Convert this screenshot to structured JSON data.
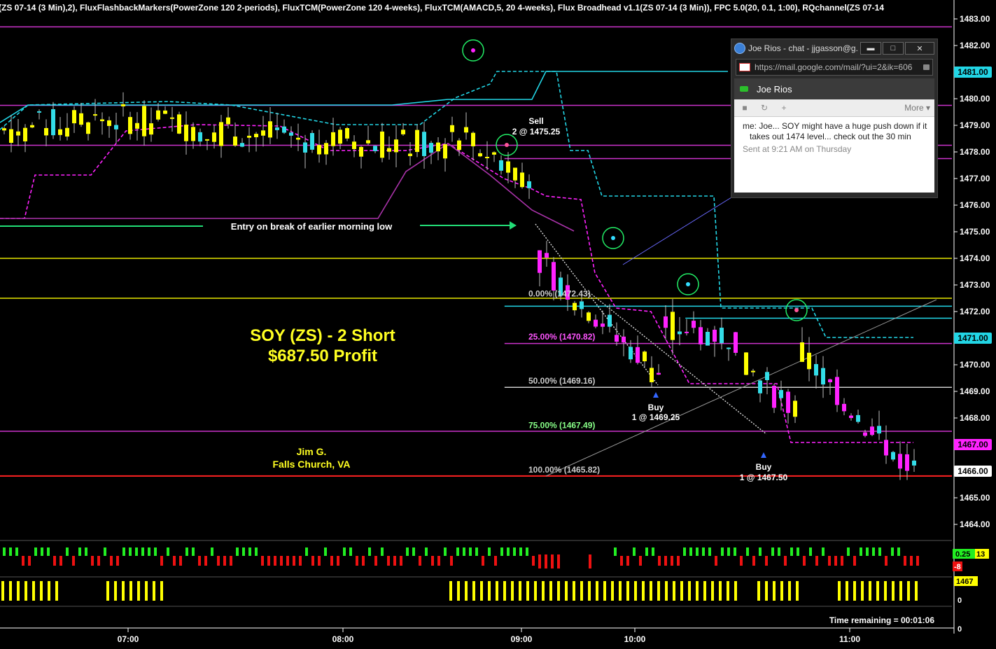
{
  "indicator_header": "(ZS 07-14 (3 Min),2),  FluxFlashbackMarkers(PowerZone 120 2-periods),  FluxTCM(PowerZone 120 4-weeks),  FluxTCM(AMACD,5, 20 4-weeks),  Flux Broadhead v1.1(ZS 07-14 (3 Min)),  FPC 5.0(20, 0.1, 1:00),  RQchannel(ZS 07-14",
  "colors": {
    "bull": "#33dde8",
    "bear": "#ff22ff",
    "neutral": "#ffff00",
    "resistance_cyan": "#22d6e6",
    "magenta_level": "#cc33cc",
    "yellow_level": "#e6e600",
    "red_level": "#ff2222",
    "fib": "#cccccc",
    "chat_video": "#2bbf2b"
  },
  "chart_data": {
    "type": "candlestick",
    "y_axis": {
      "min": 1463.5,
      "max": 1483.3,
      "ticks": [
        "1483.00",
        "1482.00",
        "1481.00",
        "1480.00",
        "1479.00",
        "1478.00",
        "1477.00",
        "1476.00",
        "1475.00",
        "1474.00",
        "1473.00",
        "1472.00",
        "1471.00",
        "1470.00",
        "1469.00",
        "1468.00",
        "1467.00",
        "1466.00",
        "1465.00",
        "1464.00"
      ]
    },
    "x_axis": {
      "ticks": [
        "07:00",
        "08:00",
        "09:00",
        "10:00",
        "11:00"
      ]
    },
    "price_badges": [
      {
        "value": "1481.00",
        "price": 1481.0,
        "color": "#22d6e6"
      },
      {
        "value": "1471.00",
        "price": 1471.0,
        "color": "#22d6e6"
      },
      {
        "value": "1467.00",
        "price": 1467.0,
        "color": "#ff22ff"
      },
      {
        "value": "1466.00",
        "price": 1466.0,
        "color": "#ffffff"
      }
    ],
    "levels": [
      {
        "price": 1482.7,
        "color": "#cc33cc"
      },
      {
        "price": 1479.75,
        "color": "#cc33cc"
      },
      {
        "price": 1478.25,
        "color": "#cc33cc"
      },
      {
        "price": 1477.75,
        "color": "#cc33cc",
        "from": 0.53
      },
      {
        "price": 1474.0,
        "color": "#e6e600"
      },
      {
        "price": 1472.5,
        "color": "#e6e600"
      },
      {
        "price": 1472.2,
        "color": "#22d6e6",
        "from": 0.53
      },
      {
        "price": 1471.75,
        "color": "#22d6e6",
        "from": 0.72
      },
      {
        "price": 1470.8,
        "color": "#cc33cc",
        "from": 0.53
      },
      {
        "price": 1469.15,
        "color": "#cccccc",
        "from": 0.53
      },
      {
        "price": 1467.5,
        "color": "#cc33cc"
      },
      {
        "price": 1465.82,
        "color": "#ff2222"
      }
    ],
    "fib_labels": [
      {
        "text": "0.00% (1472.43)",
        "price": 1472.43
      },
      {
        "text": "25.00% (1470.82)",
        "price": 1470.82
      },
      {
        "text": "50.00% (1469.16)",
        "price": 1469.16
      },
      {
        "text": "75.00% (1467.49)",
        "price": 1467.49
      },
      {
        "text": "100.00% (1465.82)",
        "price": 1465.82
      }
    ],
    "annotations": {
      "entry": "Entry on break of earlier morning low",
      "sell_1": "Sell",
      "sell_2": "2 @ 1475.25",
      "buy1_1": "Buy",
      "buy1_2": "1 @ 1469.25",
      "buy2_1": "Buy",
      "buy2_2": "1 @ 1467.50",
      "trade_1": "SOY (ZS) - 2 Short",
      "trade_2": "$687.50 Profit",
      "trader_1": "Jim G.",
      "trader_2": "Falls Church, VA",
      "time_remaining": "Time remaining = 00:01:06"
    },
    "lower_panels": {
      "momentum_badges": [
        "0.25",
        "13",
        "-8"
      ],
      "volume_badge": "1467",
      "volume_zero": "0"
    }
  },
  "chat": {
    "window_title": "Joe Rios - chat - jjgasson@g...",
    "controls": {
      "minimize": "▬",
      "maximize": "□",
      "close": "✕"
    },
    "url": "https://mail.google.com/mail/?ui=2&ik=606",
    "contact": "Joe Rios",
    "more": "More ▾",
    "sender": "me:",
    "message": "Joe... SOY might have a huge push down if it takes out 1474 level... check out the 30 min",
    "sent": "Sent at 9:21 AM on Thursday"
  }
}
